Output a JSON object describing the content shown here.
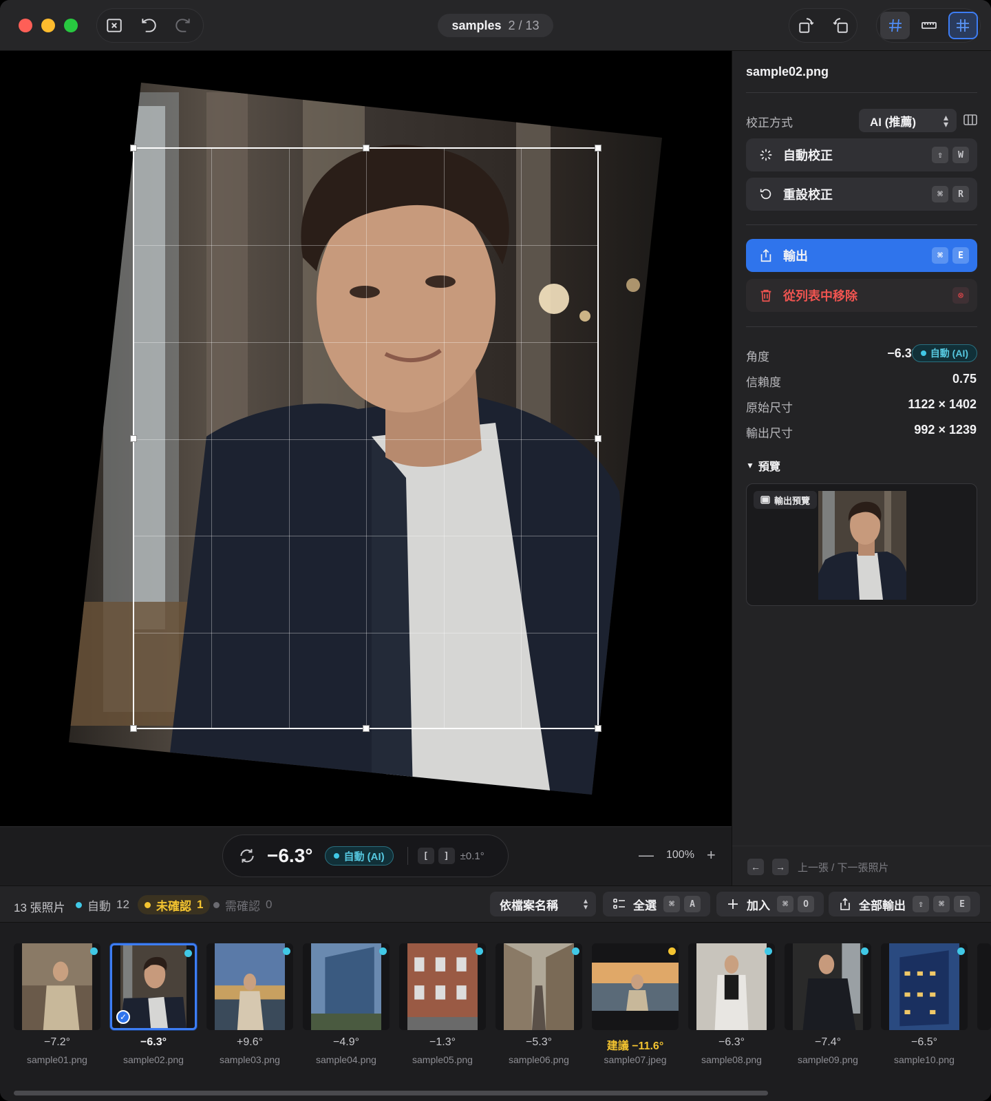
{
  "titlebar": {
    "folder": "samples",
    "counter": "2 / 13"
  },
  "canvas": {
    "angle": "−6.3°",
    "mode_badge": "自動 (AI)",
    "step_key_left": "[",
    "step_key_right": "]",
    "step": "±0.1°",
    "zoom": "100%",
    "zoom_out": "—",
    "zoom_in": "+"
  },
  "panel": {
    "filename": "sample02.png",
    "method_label": "校正方式",
    "method_value": "AI (推薦)",
    "auto_correct": {
      "label": "自動校正",
      "keys": [
        "⇧",
        "W"
      ]
    },
    "reset_correct": {
      "label": "重設校正",
      "keys": [
        "⌘",
        "R"
      ]
    },
    "export": {
      "label": "輸出",
      "keys": [
        "⌘",
        "E"
      ]
    },
    "remove": {
      "label": "從列表中移除",
      "keys": [
        "⊗"
      ]
    },
    "info": [
      {
        "label": "角度",
        "value": "−6.3°"
      },
      {
        "label": "信賴度",
        "value": "0.75"
      },
      {
        "label": "原始尺寸",
        "value": "1122 × 1402"
      },
      {
        "label": "輸出尺寸",
        "value": "992 × 1239"
      }
    ],
    "angle_badge": "自動 (AI)",
    "preview_title": "預覽",
    "preview_tag": "輸出預覽",
    "nav_prev": "←",
    "nav_next": "→",
    "nav_label": "上一張 / 下一張照片"
  },
  "statusbar": {
    "count": "13 張照片",
    "auto_label": "自動",
    "auto_count": "12",
    "unconfirmed_label": "未確認",
    "unconfirmed_count": "1",
    "needs_label": "需確認",
    "needs_count": "0",
    "sort": "依檔案名稱",
    "select_all": {
      "label": "全選",
      "keys": [
        "⌘",
        "A"
      ]
    },
    "add": {
      "label": "加入",
      "keys": [
        "⌘",
        "O"
      ]
    },
    "export_all": {
      "label": "全部輸出",
      "keys": [
        "⇧",
        "⌘",
        "E"
      ]
    }
  },
  "filmstrip": [
    {
      "angle": "−7.2°",
      "name": "sample01.png",
      "status": "auto"
    },
    {
      "angle": "−6.3°",
      "name": "sample02.png",
      "status": "auto",
      "selected": true
    },
    {
      "angle": "+9.6°",
      "name": "sample03.png",
      "status": "auto"
    },
    {
      "angle": "−4.9°",
      "name": "sample04.png",
      "status": "auto"
    },
    {
      "angle": "−1.3°",
      "name": "sample05.png",
      "status": "auto"
    },
    {
      "angle": "−5.3°",
      "name": "sample06.png",
      "status": "auto"
    },
    {
      "angle": "建議 −11.6°",
      "name": "sample07.jpeg",
      "status": "unconfirmed"
    },
    {
      "angle": "−6.3°",
      "name": "sample08.png",
      "status": "auto"
    },
    {
      "angle": "−7.4°",
      "name": "sample09.png",
      "status": "auto"
    },
    {
      "angle": "−6.5°",
      "name": "sample10.png",
      "status": "auto"
    }
  ],
  "colors": {
    "accent": "#2f74ec",
    "auto": "#40c8e6",
    "warn": "#f4c430",
    "danger": "#ef5450"
  }
}
